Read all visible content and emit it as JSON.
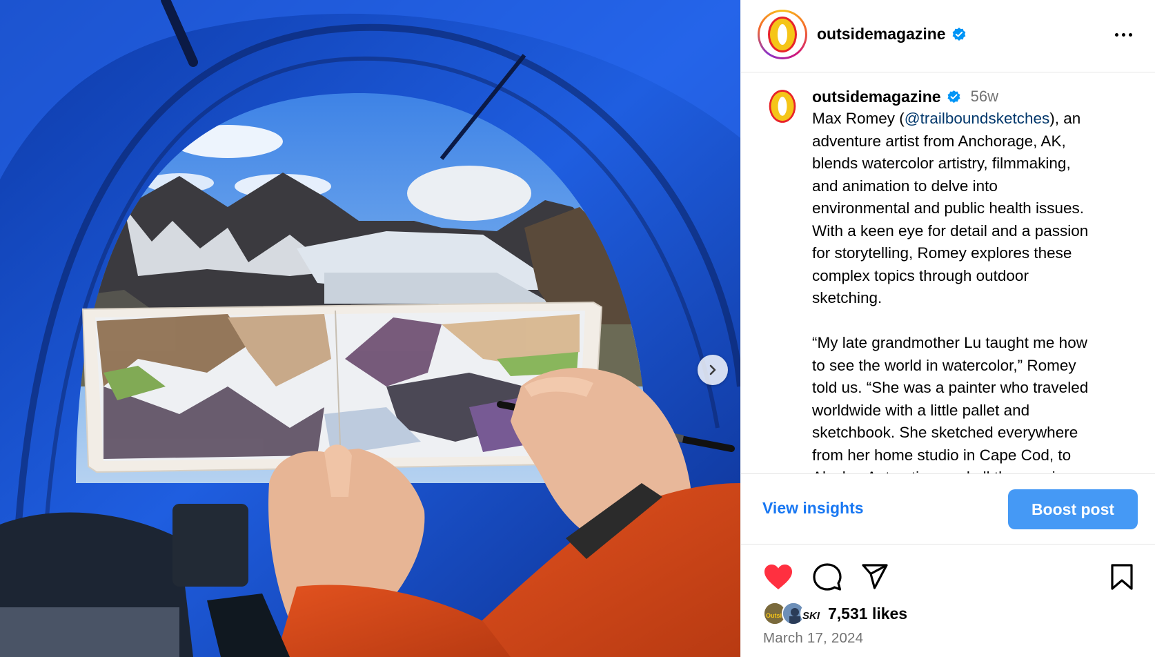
{
  "post": {
    "username": "outsidemagazine",
    "verified": true,
    "age": "56w",
    "caption": {
      "intro_name": "Max Romey (",
      "mention": "@trailboundsketches",
      "lines_para1": [
        "), an",
        "adventure artist from Anchorage, AK,",
        "blends watercolor artistry, filmmaking,",
        "and animation to delve into",
        "environmental and public health issues.",
        "With a keen eye for detail and a passion",
        "for storytelling, Romey explores these",
        "complex topics through outdoor",
        "sketching."
      ],
      "lines_para2": [
        "“My late grandmother Lu taught me how",
        "to see the world in watercolor,” Romey",
        "told us. “She was a painter who traveled",
        "worldwide with a little pallet and",
        "sketchbook. She sketched everywhere",
        "from her home studio in Cape Cod, to",
        "Alaska, Antarctica, and all the way in"
      ]
    },
    "view_insights_label": "View insights",
    "boost_label": "Boost post",
    "likes_text": "7,531 likes",
    "date": "March 17, 2024",
    "liked_by_avatar_text": [
      "Outsi",
      "",
      "SKI"
    ]
  },
  "icons": {
    "verified": "verified-badge-icon",
    "more": "more-options-icon",
    "like": "heart-filled-icon",
    "comment": "comment-icon",
    "share": "share-icon",
    "save": "bookmark-icon",
    "next": "chevron-right-icon"
  },
  "colors": {
    "accent_blue": "#1877f2",
    "boost_blue": "#4599f5",
    "like_red": "#ff3040",
    "verified_blue": "#0095f6",
    "logo_yellow": "#f5c518",
    "logo_red": "#e8232a",
    "secondary_text": "#737373"
  }
}
